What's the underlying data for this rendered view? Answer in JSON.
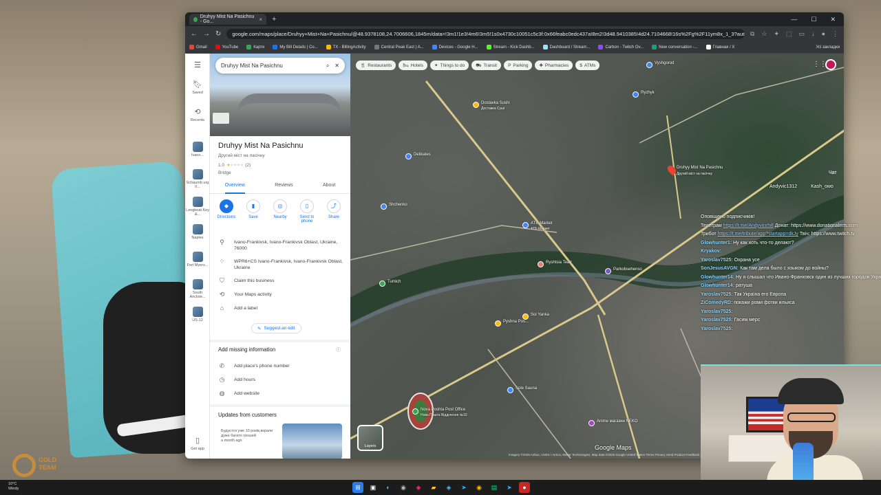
{
  "browser": {
    "tab_title": "Druhyy Mist Na Pasichnu - Go...",
    "new_tab": "+",
    "url": "google.com/maps/place/Druhyy+Mist+Na+Pasichnu/@48.9378108,24.7006606,1845m/data=!3m1!1e3!4m6!3m5!1s0x4730c10051c5c3f:0x66feabc0edc437a!8m2!3d48.9410385!4d24.7104668!16s%2Fg%2F11ym8x_1_3?authuser...",
    "bookmarks": [
      {
        "label": "Gmail",
        "color": "#ea4335"
      },
      {
        "label": "YouTube",
        "color": "#ff0000"
      },
      {
        "label": "Карти",
        "color": "#34a853"
      },
      {
        "label": "My Bill Details | Co...",
        "color": "#1a73e8"
      },
      {
        "label": "TX - BillingActivity",
        "color": "#fbbc04"
      },
      {
        "label": "Central Peak East | A...",
        "color": "#777"
      },
      {
        "label": "Devices - Google H...",
        "color": "#4285f4"
      },
      {
        "label": "Stream - Kick Dashb...",
        "color": "#53fc18"
      },
      {
        "label": "Dashboard / Stream...",
        "color": "#8be9fd"
      },
      {
        "label": "Carbon - Twitch Ov...",
        "color": "#9146ff"
      },
      {
        "label": "New conversation -...",
        "color": "#10a37f"
      },
      {
        "label": "Главная / X",
        "color": "#ffffff"
      }
    ],
    "all_bookmarks": "Усі закладки"
  },
  "rail": {
    "saved": "Saved",
    "recents": "Recents",
    "items": [
      "Ivano...",
      "Schaumb urg II...",
      "Longboat Key &...",
      "Naples",
      "Fort Myers...",
      "South Anclote...",
      "US-12"
    ],
    "get_app": "Get app"
  },
  "panel": {
    "search_value": "Druhyy Mist Na Pasichnu",
    "title": "Druhyy Mist Na Pasichnu",
    "subtitle": "Другий міст на пасічну",
    "rating": "1.0",
    "reviews_count": "(2)",
    "category": "Bridge",
    "tabs": [
      "Overview",
      "Reviews",
      "About"
    ],
    "actions": [
      "Directions",
      "Save",
      "Nearby",
      "Send to phone",
      "Share"
    ],
    "address": "Ivano-Frankivsk, Ivano-Frankivsk Oblast, Ukraine, 76000",
    "plus_code": "WPR6+CS Ivano-Frankivsk, Ivano-Frankivsk Oblast, Ukraine",
    "claim": "Claim this business",
    "activity": "Your Maps activity",
    "label": "Add a label",
    "suggest": "Suggest an edit",
    "missing_title": "Add missing information",
    "missing_items": [
      "Add place's phone number",
      "Add hours",
      "Add website"
    ],
    "updates_title": "Updates from customers",
    "update_text": "Будуєтся уже 10 років,вкрали дуже багато грошей",
    "update_time": "a month ago"
  },
  "map": {
    "chips": [
      "Restaurants",
      "Hotels",
      "Things to do",
      "Transit",
      "Parking",
      "Pharmacies",
      "ATMs"
    ],
    "pin_label": "Druhyy Mist Na Pasichnu",
    "pin_sublabel": "Другий міст на пасічну",
    "layers": "Layers",
    "google_logo": "Google Maps",
    "attribution": "Imagery ©2025 Airbus, CNES / Airbus, Maxar Technologies, Map data ©2025 Google   United States   Terms   Privacy   Send Product Feedback   200 m",
    "places": [
      {
        "name": "ATB-Market",
        "sub": "АТБ-Маркет"
      },
      {
        "name": "Ryshtsia Teatr",
        "sub": ""
      },
      {
        "name": "Parkobsehenso",
        "sub": ""
      },
      {
        "name": "Soi Yanka",
        "sub": ""
      },
      {
        "name": "Pyshna Pos...",
        "sub": ""
      },
      {
        "name": "Nova Poshta Post Office",
        "sub": "Нова Пошта Відділення №10"
      },
      {
        "name": "Sole Sauna",
        "sub": ""
      },
      {
        "name": "Anime магазин NEKO",
        "sub": ""
      },
      {
        "name": "Dostavka Sushi",
        "sub": "Доставка Суші"
      },
      {
        "name": "Shchenko",
        "sub": ""
      },
      {
        "name": "Delikates",
        "sub": ""
      },
      {
        "name": "Vyshgorod",
        "sub": ""
      },
      {
        "name": "Ryzhyk",
        "sub": ""
      },
      {
        "name": "Tumich",
        "sub": ""
      }
    ]
  },
  "chat": {
    "label": "Чат",
    "header_users": [
      "Andyvic1312",
      "Kash_owo"
    ],
    "messages": [
      {
        "user": "",
        "text": "Оповіщено подписчиків!"
      },
      {
        "user": "",
        "text": "Телеграм",
        "link": "https://t.me/Andyvicchill",
        "extra": "Донат: https://www.donationalerts.com"
      },
      {
        "user": "",
        "text": "Трибот",
        "link": "https://t.me/tribute/app?startapp=dkJy",
        "extra": "Твіч: https://www.twitch.tv"
      },
      {
        "user": "Glowhunter1:",
        "text": "Ну как хоть что-то делают?"
      },
      {
        "user": "Kryakov:",
        "text": ""
      },
      {
        "user": "Yaroslav7525:",
        "text": "Охрана усе"
      },
      {
        "user": "SonJesusAVGN:",
        "text": "Как там дела было с языком до войны?"
      },
      {
        "user": "Glowhunter14:",
        "text": "Ну я слышал что Ивано-Франковск один из лучших городов Украины"
      },
      {
        "user": "Glowhunter14:",
        "text": "ратуша"
      },
      {
        "user": "Yaroslav7525:",
        "text": "Так Україна его Европа"
      },
      {
        "user": "ZiComedyRD:",
        "text": "покажи роми фотки ильиса"
      },
      {
        "user": "Yaroslav7525:",
        "text": ""
      },
      {
        "user": "Yaroslav7525:",
        "text": "Гасим мерс"
      },
      {
        "user": "Yaroslav7525:",
        "text": ""
      }
    ]
  },
  "taskbar": {
    "temp": "10°C",
    "condition": "Windy"
  },
  "watermark": "GOLD TEAM"
}
